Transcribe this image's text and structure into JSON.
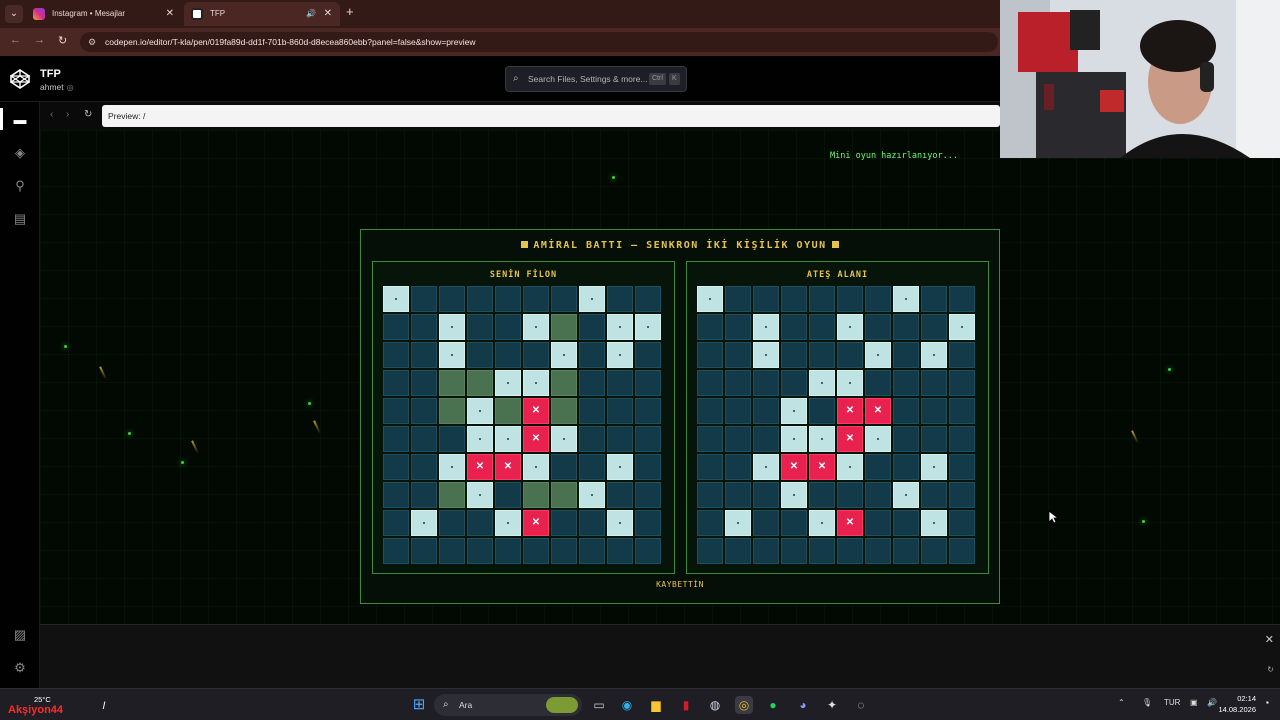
{
  "browser": {
    "tabs": [
      {
        "label": "Instagram • Mesajlar",
        "active": false
      },
      {
        "label": "TFP",
        "active": true
      }
    ],
    "url": "codepen.io/editor/T-kla/pen/019fa89d-dd1f-701b-860d-d8ecea860ebb?panel=false&show=preview"
  },
  "codepen": {
    "project_title": "TFP",
    "user": "ahmet",
    "search_placeholder": "Search Files, Settings & more...",
    "search_shortcut_1": "Ctrl",
    "search_shortcut_2": "K",
    "preview_path": "Preview: /"
  },
  "game": {
    "status": "Mini oyun hazırlanıyor...",
    "title": "AMİRAL BATTI — SENKRON İKİ KİŞİLİK OYUN",
    "left_board_title": "SENİN FİLON",
    "right_board_title": "ATEŞ ALANI",
    "result": "KAYBETTİN",
    "legend_cells": {
      "empty": "e",
      "ship": "s",
      "miss": "m",
      "hit": "h"
    },
    "left_grid": [
      "meeeeeemee",
      "eemeemsemm",
      "eemeeememe",
      "eessmmseee",
      "eesmshseee",
      "eeemmhmeee",
      "eemhhmeeme",
      "eesmessmee",
      "emeemheeme",
      "eeeeeeeeee"
    ],
    "right_grid": [
      "meeeeeemee",
      "eemeemeeem",
      "eemeeememe",
      "eeeemmeeee",
      "eeemehaeee",
      "eeemmhmeee",
      "eemhhmeeme",
      "eeemeeemee",
      "emeemheeme",
      "eeeeeeeeee"
    ],
    "colors": {
      "empty": "#123a48",
      "ship": "#4a7150",
      "miss": "#bfe2e2",
      "hit": "#e8214f",
      "accent": "#e6c34c",
      "status": "#66ff66"
    }
  },
  "taskbar": {
    "temperature": "25°C",
    "overlay_text": "Akşiyon44",
    "search_label": "Ara",
    "language": "TUR",
    "time": "02:14",
    "date": "14.08.2026"
  }
}
